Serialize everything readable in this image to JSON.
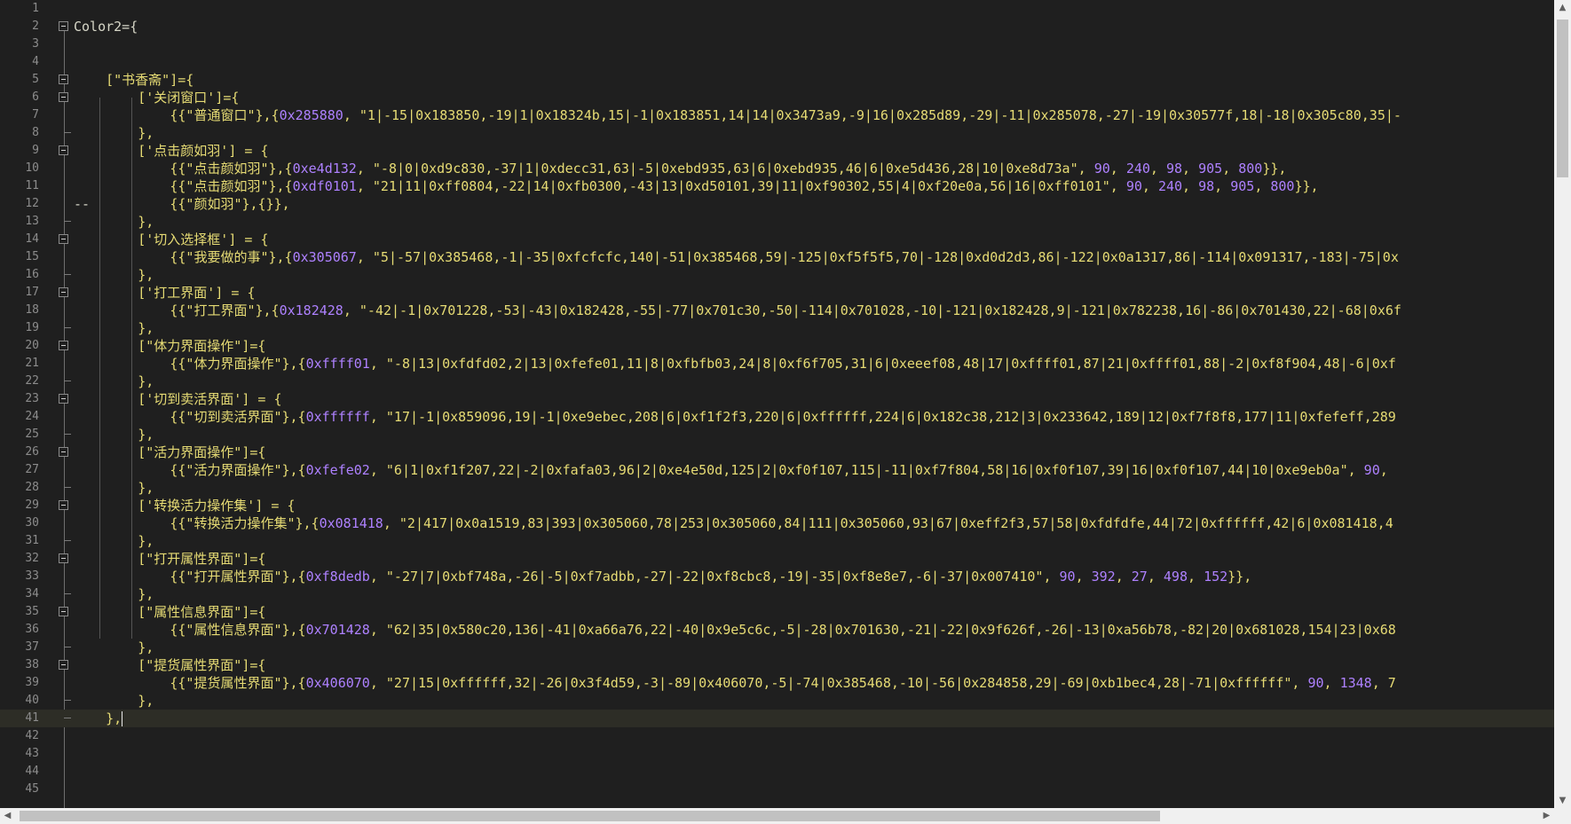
{
  "editor": {
    "lines": [
      {
        "n": "1",
        "segs": []
      },
      {
        "n": "2",
        "fold": true,
        "segs": [
          {
            "t": "Color2={"
          }
        ]
      },
      {
        "n": "3",
        "segs": []
      },
      {
        "n": "4",
        "segs": []
      },
      {
        "n": "5",
        "fold": true,
        "segs": [
          {
            "t": "    "
          },
          {
            "t": "[\"书香斋\"]={",
            "c": "hl"
          }
        ]
      },
      {
        "n": "6",
        "fold": true,
        "segs": [
          {
            "t": "        "
          },
          {
            "t": "['关闭窗口']={",
            "c": "hl"
          }
        ]
      },
      {
        "n": "7",
        "segs": [
          {
            "t": "            "
          },
          {
            "t": "{{\"普通窗口\"},{",
            "c": "hl"
          },
          {
            "t": "0x285880",
            "c": "nm"
          },
          {
            "t": ", ",
            "c": "hl"
          },
          {
            "t": "\"1|-15|0x183850,-19|1|0x18324b,15|-1|0x183851,14|14|0x3473a9,-9|16|0x285d89,-29|-11|0x285078,-27|-19|0x30577f,18|-18|0x305c80,35|-",
            "c": "hl"
          }
        ]
      },
      {
        "n": "8",
        "foldend": true,
        "segs": [
          {
            "t": "        "
          },
          {
            "t": "},",
            "c": "hl"
          }
        ]
      },
      {
        "n": "9",
        "fold": true,
        "segs": [
          {
            "t": "        "
          },
          {
            "t": "['点击颜如羽'] = {",
            "c": "hl"
          }
        ]
      },
      {
        "n": "10",
        "segs": [
          {
            "t": "            "
          },
          {
            "t": "{{\"点击颜如羽\"},{",
            "c": "hl"
          },
          {
            "t": "0xe4d132",
            "c": "nm"
          },
          {
            "t": ", ",
            "c": "hl"
          },
          {
            "t": "\"-8|0|0xd9c830,-37|1|0xdecc31,63|-5|0xebd935,63|6|0xebd935,46|6|0xe5d436,28|10|0xe8d73a\"",
            "c": "hl"
          },
          {
            "t": ", ",
            "c": "hl"
          },
          {
            "t": "90",
            "c": "nm"
          },
          {
            "t": ", ",
            "c": "hl"
          },
          {
            "t": "240",
            "c": "nm"
          },
          {
            "t": ", ",
            "c": "hl"
          },
          {
            "t": "98",
            "c": "nm"
          },
          {
            "t": ", ",
            "c": "hl"
          },
          {
            "t": "905",
            "c": "nm"
          },
          {
            "t": ", ",
            "c": "hl"
          },
          {
            "t": "800",
            "c": "nm"
          },
          {
            "t": "}},",
            "c": "hl"
          }
        ]
      },
      {
        "n": "11",
        "segs": [
          {
            "t": "            "
          },
          {
            "t": "{{\"点击颜如羽\"},{",
            "c": "hl"
          },
          {
            "t": "0xdf0101",
            "c": "nm"
          },
          {
            "t": ", ",
            "c": "hl"
          },
          {
            "t": "\"21|11|0xff0804,-22|14|0xfb0300,-43|13|0xd50101,39|11|0xf90302,55|4|0xf20e0a,56|16|0xff0101\"",
            "c": "hl"
          },
          {
            "t": ", ",
            "c": "hl"
          },
          {
            "t": "90",
            "c": "nm"
          },
          {
            "t": ", ",
            "c": "hl"
          },
          {
            "t": "240",
            "c": "nm"
          },
          {
            "t": ", ",
            "c": "hl"
          },
          {
            "t": "98",
            "c": "nm"
          },
          {
            "t": ", ",
            "c": "hl"
          },
          {
            "t": "905",
            "c": "nm"
          },
          {
            "t": ", ",
            "c": "hl"
          },
          {
            "t": "800",
            "c": "nm"
          },
          {
            "t": "}},",
            "c": "hl"
          }
        ]
      },
      {
        "n": "12",
        "segs": [
          {
            "t": "--          "
          },
          {
            "t": "{{\"颜如羽\"},{}},",
            "c": "hl"
          }
        ]
      },
      {
        "n": "13",
        "foldend": true,
        "segs": [
          {
            "t": "        "
          },
          {
            "t": "},",
            "c": "hl"
          }
        ]
      },
      {
        "n": "14",
        "fold": true,
        "segs": [
          {
            "t": "        "
          },
          {
            "t": "['切入选择框'] = {",
            "c": "hl"
          }
        ]
      },
      {
        "n": "15",
        "segs": [
          {
            "t": "            "
          },
          {
            "t": "{{\"我要做的事\"},{",
            "c": "hl"
          },
          {
            "t": "0x305067",
            "c": "nm"
          },
          {
            "t": ", ",
            "c": "hl"
          },
          {
            "t": "\"5|-57|0x385468,-1|-35|0xfcfcfc,140|-51|0x385468,59|-125|0xf5f5f5,70|-128|0xd0d2d3,86|-122|0x0a1317,86|-114|0x091317,-183|-75|0x",
            "c": "hl"
          }
        ]
      },
      {
        "n": "16",
        "foldend": true,
        "segs": [
          {
            "t": "        "
          },
          {
            "t": "},",
            "c": "hl"
          }
        ]
      },
      {
        "n": "17",
        "fold": true,
        "segs": [
          {
            "t": "        "
          },
          {
            "t": "['打工界面'] = {",
            "c": "hl"
          }
        ]
      },
      {
        "n": "18",
        "segs": [
          {
            "t": "            "
          },
          {
            "t": "{{\"打工界面\"},{",
            "c": "hl"
          },
          {
            "t": "0x182428",
            "c": "nm"
          },
          {
            "t": ", ",
            "c": "hl"
          },
          {
            "t": "\"-42|-1|0x701228,-53|-43|0x182428,-55|-77|0x701c30,-50|-114|0x701028,-10|-121|0x182428,9|-121|0x782238,16|-86|0x701430,22|-68|0x6f",
            "c": "hl"
          }
        ]
      },
      {
        "n": "19",
        "foldend": true,
        "segs": [
          {
            "t": "        "
          },
          {
            "t": "},",
            "c": "hl"
          }
        ]
      },
      {
        "n": "20",
        "fold": true,
        "segs": [
          {
            "t": "        "
          },
          {
            "t": "[\"体力界面操作\"]={",
            "c": "hl"
          }
        ]
      },
      {
        "n": "21",
        "segs": [
          {
            "t": "            "
          },
          {
            "t": "{{\"体力界面操作\"},{",
            "c": "hl"
          },
          {
            "t": "0xffff01",
            "c": "nm"
          },
          {
            "t": ", ",
            "c": "hl"
          },
          {
            "t": "\"-8|13|0xfdfd02,2|13|0xfefe01,11|8|0xfbfb03,24|8|0xf6f705,31|6|0xeeef08,48|17|0xffff01,87|21|0xffff01,88|-2|0xf8f904,48|-6|0xf",
            "c": "hl"
          }
        ]
      },
      {
        "n": "22",
        "foldend": true,
        "segs": [
          {
            "t": "        "
          },
          {
            "t": "},",
            "c": "hl"
          }
        ]
      },
      {
        "n": "23",
        "fold": true,
        "segs": [
          {
            "t": "        "
          },
          {
            "t": "['切到卖活界面'] = {",
            "c": "hl"
          }
        ]
      },
      {
        "n": "24",
        "segs": [
          {
            "t": "            "
          },
          {
            "t": "{{\"切到卖活界面\"},{",
            "c": "hl"
          },
          {
            "t": "0xffffff",
            "c": "nm"
          },
          {
            "t": ", ",
            "c": "hl"
          },
          {
            "t": "\"17|-1|0x859096,19|-1|0xe9ebec,208|6|0xf1f2f3,220|6|0xffffff,224|6|0x182c38,212|3|0x233642,189|12|0xf7f8f8,177|11|0xfefeff,289",
            "c": "hl"
          }
        ]
      },
      {
        "n": "25",
        "foldend": true,
        "segs": [
          {
            "t": "        "
          },
          {
            "t": "},",
            "c": "hl"
          }
        ]
      },
      {
        "n": "26",
        "fold": true,
        "segs": [
          {
            "t": "        "
          },
          {
            "t": "[\"活力界面操作\"]={",
            "c": "hl"
          }
        ]
      },
      {
        "n": "27",
        "segs": [
          {
            "t": "            "
          },
          {
            "t": "{{\"活力界面操作\"},{",
            "c": "hl"
          },
          {
            "t": "0xfefe02",
            "c": "nm"
          },
          {
            "t": ", ",
            "c": "hl"
          },
          {
            "t": "\"6|1|0xf1f207,22|-2|0xfafa03,96|2|0xe4e50d,125|2|0xf0f107,115|-11|0xf7f804,58|16|0xf0f107,39|16|0xf0f107,44|10|0xe9eb0a\"",
            "c": "hl"
          },
          {
            "t": ", ",
            "c": "hl"
          },
          {
            "t": "90",
            "c": "nm"
          },
          {
            "t": ", ",
            "c": "hl"
          }
        ]
      },
      {
        "n": "28",
        "foldend": true,
        "segs": [
          {
            "t": "        "
          },
          {
            "t": "},",
            "c": "hl"
          }
        ]
      },
      {
        "n": "29",
        "fold": true,
        "segs": [
          {
            "t": "        "
          },
          {
            "t": "['转换活力操作集'] = {",
            "c": "hl"
          }
        ]
      },
      {
        "n": "30",
        "segs": [
          {
            "t": "            "
          },
          {
            "t": "{{\"转换活力操作集\"},{",
            "c": "hl"
          },
          {
            "t": "0x081418",
            "c": "nm"
          },
          {
            "t": ", ",
            "c": "hl"
          },
          {
            "t": "\"2|417|0x0a1519,83|393|0x305060,78|253|0x305060,84|111|0x305060,93|67|0xeff2f3,57|58|0xfdfdfe,44|72|0xffffff,42|6|0x081418,4",
            "c": "hl"
          }
        ]
      },
      {
        "n": "31",
        "foldend": true,
        "segs": [
          {
            "t": "        "
          },
          {
            "t": "},",
            "c": "hl"
          }
        ]
      },
      {
        "n": "32",
        "fold": true,
        "segs": [
          {
            "t": "        "
          },
          {
            "t": "[\"打开属性界面\"]={",
            "c": "hl"
          }
        ]
      },
      {
        "n": "33",
        "segs": [
          {
            "t": "            "
          },
          {
            "t": "{{\"打开属性界面\"},{",
            "c": "hl"
          },
          {
            "t": "0xf8dedb",
            "c": "nm"
          },
          {
            "t": ", ",
            "c": "hl"
          },
          {
            "t": "\"-27|7|0xbf748a,-26|-5|0xf7adbb,-27|-22|0xf8cbc8,-19|-35|0xf8e8e7,-6|-37|0x007410\"",
            "c": "hl"
          },
          {
            "t": ", ",
            "c": "hl"
          },
          {
            "t": "90",
            "c": "nm"
          },
          {
            "t": ", ",
            "c": "hl"
          },
          {
            "t": "392",
            "c": "nm"
          },
          {
            "t": ", ",
            "c": "hl"
          },
          {
            "t": "27",
            "c": "nm"
          },
          {
            "t": ", ",
            "c": "hl"
          },
          {
            "t": "498",
            "c": "nm"
          },
          {
            "t": ", ",
            "c": "hl"
          },
          {
            "t": "152",
            "c": "nm"
          },
          {
            "t": "}},",
            "c": "hl"
          }
        ]
      },
      {
        "n": "34",
        "foldend": true,
        "segs": [
          {
            "t": "        "
          },
          {
            "t": "},",
            "c": "hl"
          }
        ]
      },
      {
        "n": "35",
        "fold": true,
        "segs": [
          {
            "t": "        "
          },
          {
            "t": "[\"属性信息界面\"]={",
            "c": "hl"
          }
        ]
      },
      {
        "n": "36",
        "segs": [
          {
            "t": "            "
          },
          {
            "t": "{{\"属性信息界面\"},{",
            "c": "hl"
          },
          {
            "t": "0x701428",
            "c": "nm"
          },
          {
            "t": ", ",
            "c": "hl"
          },
          {
            "t": "\"62|35|0x580c20,136|-41|0xa66a76,22|-40|0x9e5c6c,-5|-28|0x701630,-21|-22|0x9f626f,-26|-13|0xa56b78,-82|20|0x681028,154|23|0x68",
            "c": "hl"
          }
        ]
      },
      {
        "n": "37",
        "foldend": true,
        "segs": [
          {
            "t": "        "
          },
          {
            "t": "},",
            "c": "hl"
          }
        ]
      },
      {
        "n": "38",
        "fold": true,
        "segs": [
          {
            "t": "        "
          },
          {
            "t": "[\"提货属性界面\"]={",
            "c": "hl"
          }
        ]
      },
      {
        "n": "39",
        "segs": [
          {
            "t": "            "
          },
          {
            "t": "{{\"提货属性界面\"},{",
            "c": "hl"
          },
          {
            "t": "0x406070",
            "c": "nm"
          },
          {
            "t": ", ",
            "c": "hl"
          },
          {
            "t": "\"27|15|0xffffff,32|-26|0x3f4d59,-3|-89|0x406070,-5|-74|0x385468,-10|-56|0x284858,29|-69|0xb1bec4,28|-71|0xffffff\"",
            "c": "hl"
          },
          {
            "t": ", ",
            "c": "hl"
          },
          {
            "t": "90",
            "c": "nm"
          },
          {
            "t": ", ",
            "c": "hl"
          },
          {
            "t": "1348",
            "c": "nm"
          },
          {
            "t": ", 7",
            "c": "hl"
          }
        ]
      },
      {
        "n": "40",
        "foldend": true,
        "segs": [
          {
            "t": "        "
          },
          {
            "t": "},",
            "c": "hl"
          }
        ]
      },
      {
        "n": "41",
        "foldend": true,
        "current": true,
        "cursor": true,
        "segs": [
          {
            "t": "    "
          },
          {
            "t": "},",
            "c": "hl"
          }
        ]
      },
      {
        "n": "42",
        "segs": []
      },
      {
        "n": "43",
        "segs": []
      },
      {
        "n": "44",
        "segs": []
      },
      {
        "n": "45",
        "segs": []
      }
    ]
  },
  "scrollbars": {
    "up_arrow_icon": "▲",
    "down_arrow_icon": "▼",
    "left_arrow_icon": "◀",
    "right_arrow_icon": "▶"
  },
  "colors": {
    "background": "#1f1f1f",
    "text": "#d7d7c8",
    "string": "#e6db74",
    "number": "#ae81ff",
    "line_number": "#8c8c8c",
    "current_line": "#2d2d26"
  }
}
